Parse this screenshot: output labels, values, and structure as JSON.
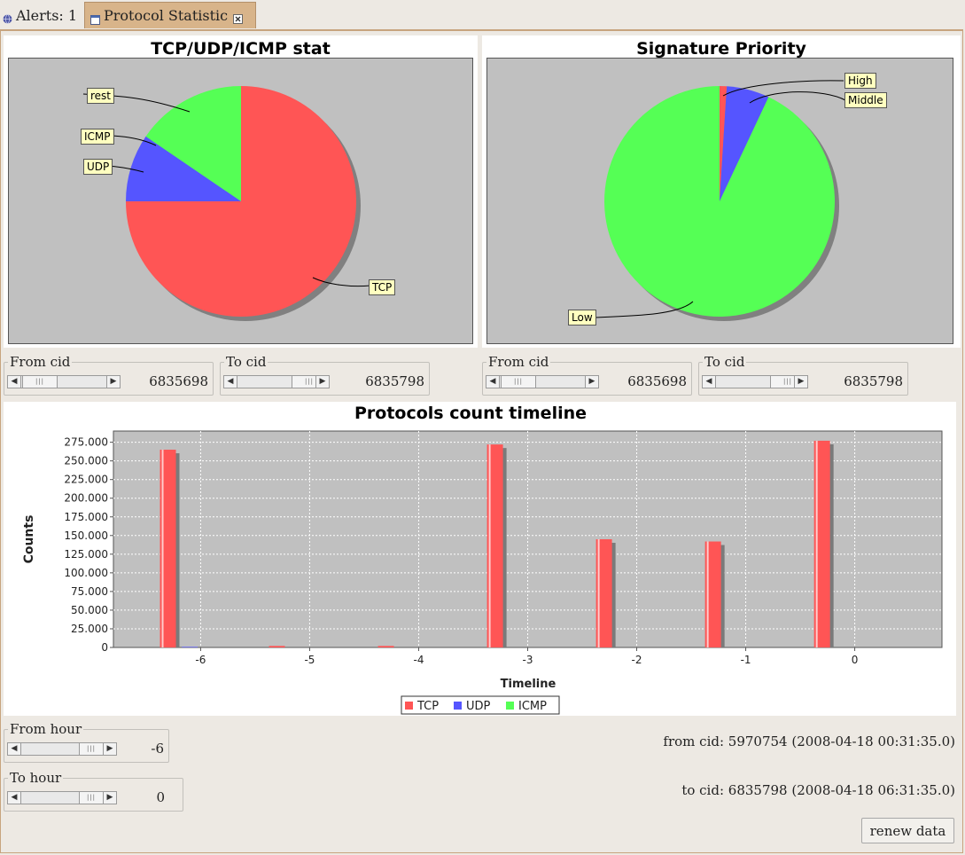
{
  "tabs": [
    {
      "label": "Alerts: 1",
      "icon": "globe-icon"
    },
    {
      "label": "Protocol Statistic",
      "icon": "window-icon",
      "close_icon": "close-icon"
    }
  ],
  "colors": {
    "tcp": "#ff5555",
    "udp": "#5555ff",
    "icmp": "#55ff55",
    "plot_bg": "#c0c0c0",
    "tab_active": "#d8b48a"
  },
  "protocol_panel": {
    "from": {
      "label": "From cid",
      "value": "6835698"
    },
    "to": {
      "label": "To cid",
      "value": "6835798"
    }
  },
  "priority_panel": {
    "from": {
      "label": "From cid",
      "value": "6835698"
    },
    "to": {
      "label": "To cid",
      "value": "6835798"
    }
  },
  "hours": {
    "from": {
      "label": "From hour",
      "value": "-6"
    },
    "to": {
      "label": "To hour",
      "value": "0"
    }
  },
  "info": {
    "from_cid": "from cid: 5970754  (2008-04-18 00:31:35.0)",
    "to_cid": "to cid: 6835798  (2008-04-18 06:31:35.0)"
  },
  "renew_button": "renew data",
  "chart_data": [
    {
      "type": "pie",
      "title": "TCP/UDP/ICMP stat",
      "slices": [
        {
          "label": "TCP",
          "value": 75.0
        },
        {
          "label": "UDP",
          "value": 9.5
        },
        {
          "label": "ICMP",
          "value": 0.0
        },
        {
          "label": "rest",
          "value": 15.5
        }
      ]
    },
    {
      "type": "pie",
      "title": "Signature Priority",
      "slices": [
        {
          "label": "High",
          "value": 1.0
        },
        {
          "label": "Middle",
          "value": 6.0
        },
        {
          "label": "Low",
          "value": 93.0
        }
      ]
    },
    {
      "type": "bar",
      "title": "Protocols count timeline",
      "xlabel": "Timeline",
      "ylabel": "Counts",
      "categories": [
        "-6",
        "-5",
        "-4",
        "-3",
        "-2",
        "-1",
        "0"
      ],
      "xlim": [
        -6.8,
        0.8
      ],
      "ylim": [
        0,
        290000
      ],
      "yticks": [
        "0",
        "25.000",
        "50.000",
        "75.000",
        "100.000",
        "125.000",
        "150.000",
        "175.000",
        "200.000",
        "225.000",
        "250.000",
        "275.000"
      ],
      "series": [
        {
          "name": "TCP",
          "x": [
            -6.3,
            -5.3,
            -4.3,
            -3.3,
            -2.3,
            -1.3,
            -0.3
          ],
          "values": [
            265000,
            2000,
            2000,
            272000,
            145000,
            142000,
            277000
          ]
        },
        {
          "name": "UDP",
          "x": [
            -6.1,
            -5.1,
            -4.1,
            -3.1,
            -2.1,
            -1.1,
            -0.1
          ],
          "values": [
            800,
            0,
            0,
            0,
            0,
            0,
            0
          ]
        },
        {
          "name": "ICMP",
          "x": [
            -5.9,
            -4.9,
            -3.9,
            -2.9,
            -1.9,
            -0.9,
            0.1
          ],
          "values": [
            0,
            0,
            0,
            0,
            0,
            0,
            0
          ]
        }
      ],
      "grid": true,
      "legend": "bottom-center"
    }
  ]
}
